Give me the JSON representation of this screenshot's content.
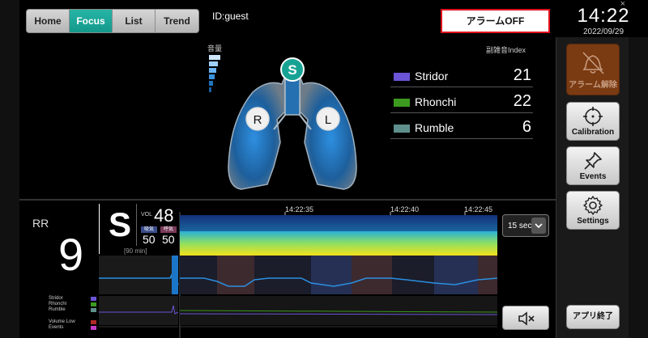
{
  "tabs": [
    {
      "label": "Home",
      "active": false
    },
    {
      "label": "Focus",
      "active": true
    },
    {
      "label": "List",
      "active": false
    },
    {
      "label": "Trend",
      "active": false
    }
  ],
  "user_id": "ID:guest",
  "alarm_off_label": "アラームOFF",
  "clock": {
    "time": "14:22",
    "date": "2022/09/29"
  },
  "close_glyph": "×",
  "sidebar": {
    "alarm_release": "アラーム解除",
    "calibration": "Calibration",
    "events": "Events",
    "settings": "Settings",
    "app_exit": "アプリ終了"
  },
  "lungs": {
    "volume_label": "音量",
    "center_marker": "S",
    "right_marker": "R",
    "left_marker": "L"
  },
  "noise_index": {
    "label": "副雑音Index",
    "items": [
      {
        "name": "Stridor",
        "value": "21",
        "color": "#6b55d6"
      },
      {
        "name": "Rhonchi",
        "value": "22",
        "color": "#3c9a1f"
      },
      {
        "name": "Rumble",
        "value": "6",
        "color": "#5f8f8c"
      }
    ]
  },
  "vitals": {
    "rr_label": "RR",
    "rr_value": "9",
    "state": "S",
    "vol_label": "VOL",
    "vol_value": "48",
    "inhale_label": "吸気",
    "exhale_label": "呼気",
    "inhale_value": "50",
    "exhale_value": "50",
    "window_label": "[90 min]"
  },
  "timeline": {
    "times": [
      "14:22:35",
      "14:22:40",
      "14:22:45"
    ],
    "window": "15 sec"
  },
  "trend_legend": [
    "Stridor",
    "Rhonchi",
    "Rumble",
    "Volume Low",
    "Events"
  ],
  "colors": {
    "accent": "#14998b",
    "alarm_border": "#e0141e",
    "stridor": "#6b55d6",
    "rhonchi": "#3c9a1f",
    "rumble": "#5f8f8c",
    "volume_low": "#b02a2a",
    "events": "#c43cc4"
  }
}
